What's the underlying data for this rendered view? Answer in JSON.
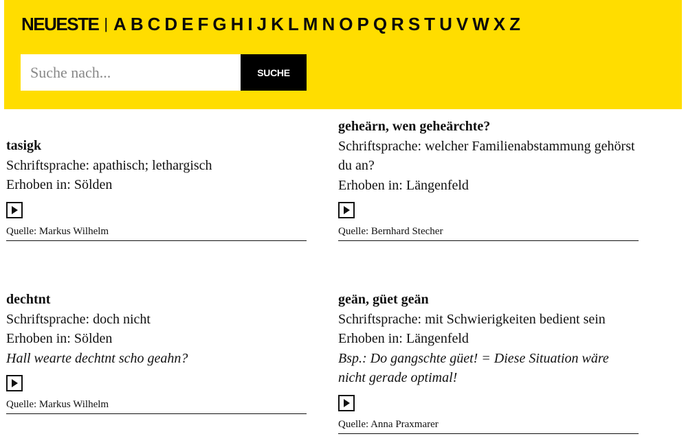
{
  "nav": {
    "newest": "NEUESTE",
    "separator": "|",
    "letters": [
      "A",
      "B",
      "C",
      "D",
      "E",
      "F",
      "G",
      "H",
      "I",
      "J",
      "K",
      "L",
      "M",
      "N",
      "O",
      "P",
      "Q",
      "R",
      "S",
      "T",
      "U",
      "V",
      "W",
      "X",
      "Z"
    ]
  },
  "search": {
    "placeholder": "Suche nach...",
    "button": "SUCHE"
  },
  "entries": [
    {
      "term": "tasigk",
      "standard": "Schriftsprache: apathisch; lethargisch",
      "location": "Erhoben in: Sölden",
      "example": "",
      "source": "Quelle: Markus Wilhelm"
    },
    {
      "term": "geheärn, wen geheärchte?",
      "standard": "Schriftsprache: welcher Familienabstammung gehörst du an?",
      "location": "Erhoben in: Längenfeld",
      "example": "",
      "source": "Quelle: Bernhard Stecher"
    },
    {
      "term": "dechtnt",
      "standard": "Schriftsprache: doch nicht",
      "location": "Erhoben in: Sölden",
      "example": "Hall wearte dechtnt scho geahn?",
      "source": "Quelle: Markus Wilhelm"
    },
    {
      "term": "geän, güet geän",
      "standard": "Schriftsprache: mit Schwierigkeiten bedient sein",
      "location": "Erhoben in: Längenfeld",
      "example": "Bsp.: Do gangschte güet! = Diese Situation wäre nicht gerade optimal!",
      "source": "Quelle: Anna Praxmarer"
    }
  ],
  "colors": {
    "header_bg": "#ffdd00",
    "button_bg": "#000000",
    "text": "#111111"
  },
  "icons": {
    "play": "play-icon"
  }
}
